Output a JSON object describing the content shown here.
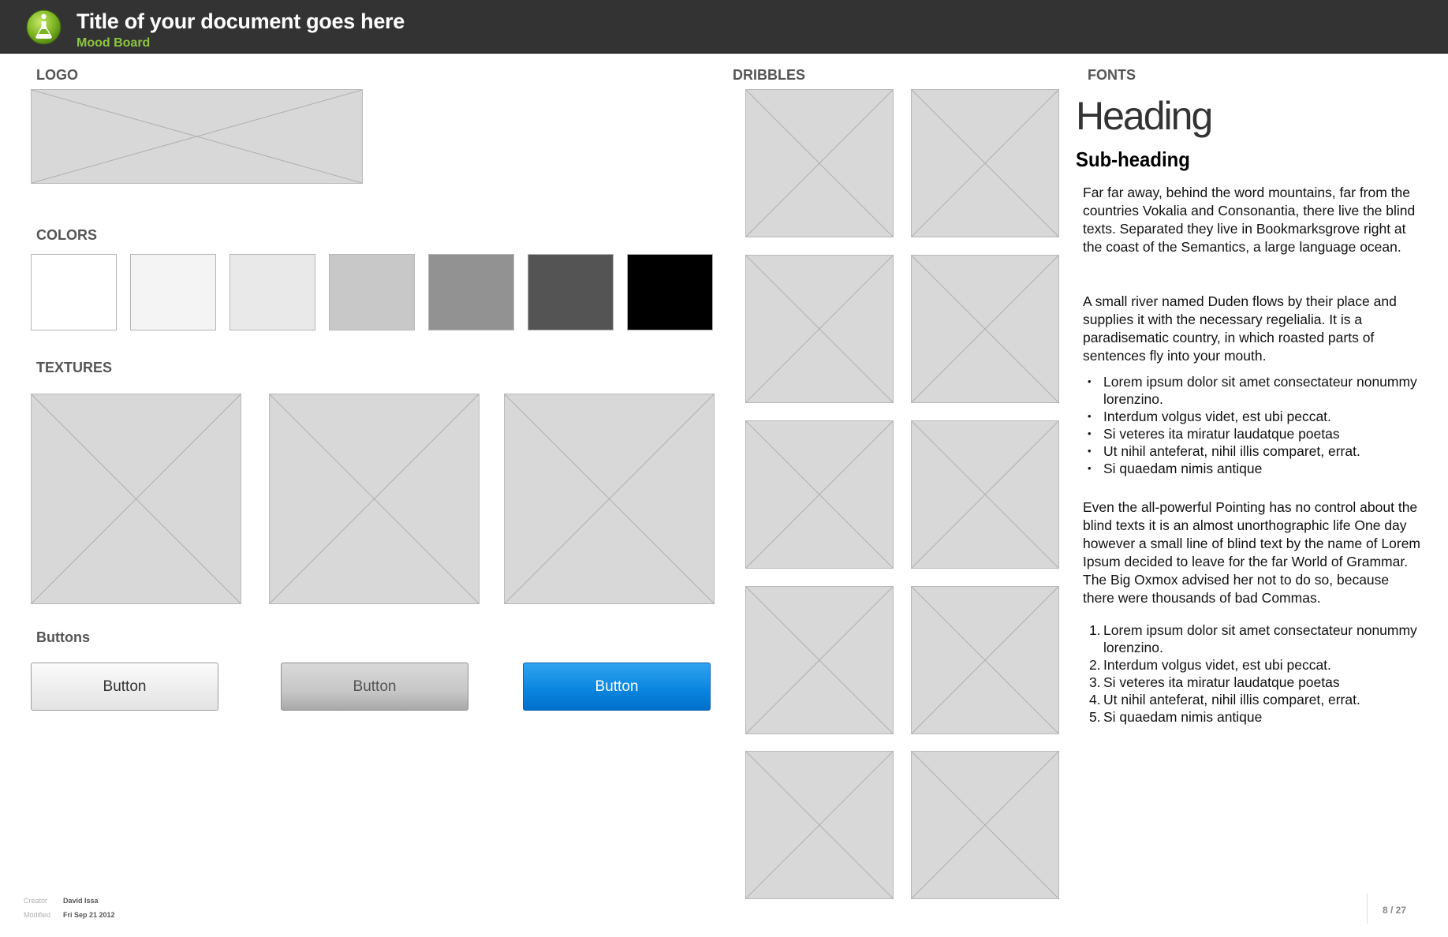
{
  "header": {
    "title": "Title of your document goes here",
    "subtitle": "Mood Board",
    "logo_icon": "flask-icon",
    "accent_color": "#8cc63f",
    "background_color": "#333333"
  },
  "sections": {
    "logo": "LOGO",
    "colors": "COLORS",
    "textures": "TEXTURES",
    "buttons": "Buttons",
    "dribbles": "DRIBBLES",
    "fonts": "FONTS"
  },
  "colors": [
    "#ffffff",
    "#f4f4f4",
    "#e9e9e9",
    "#c8c8c8",
    "#929292",
    "#545454",
    "#000000"
  ],
  "buttons": [
    {
      "label": "Button",
      "style": "default"
    },
    {
      "label": "Button",
      "style": "pressed"
    },
    {
      "label": "Button",
      "style": "primary",
      "color": "#0b86e0"
    }
  ],
  "fonts": {
    "heading": "Heading",
    "subheading": "Sub-heading",
    "paragraph1": "Far far away, behind the word mountains, far from the countries Vokalia and Consonantia, there live the blind texts. Separated they live in Bookmarksgrove right at the coast of the Semantics, a large language ocean.",
    "paragraph2": "A small river named Duden flows by their place and supplies it with the necessary regelialia. It is a paradisematic country, in which roasted parts of sentences fly into your mouth.",
    "bullets": [
      "Lorem ipsum dolor sit amet consectateur nonummy lorenzino.",
      "Interdum volgus videt, est ubi peccat.",
      "Si veteres ita miratur laudatque poetas",
      "Ut nihil anteferat, nihil illis comparet, errat.",
      "Si quaedam nimis antique"
    ],
    "paragraph3": "Even the all-powerful Pointing has no control about the blind texts it is an almost unorthographic life One day however a small line of blind text by the name of Lorem Ipsum decided to leave for the far World of Grammar. The Big Oxmox advised her not to do so, because there were thousands of bad Commas.",
    "numbered": [
      {
        "num": "1.",
        "text": "Lorem ipsum dolor sit amet consectateur nonummy lorenzino."
      },
      {
        "num": "2.",
        "text": "Interdum volgus videt, est ubi peccat."
      },
      {
        "num": "3.",
        "text": "Si veteres ita miratur laudatque poetas"
      },
      {
        "num": "4.",
        "text": "Ut nihil anteferat, nihil illis comparet, errat."
      },
      {
        "num": "5.",
        "text": "Si quaedam nimis antique"
      }
    ]
  },
  "footer": {
    "creator_label": "Creator",
    "creator_value": "David Issa",
    "modified_label": "Modified",
    "modified_value": "Fri Sep 21 2012",
    "page": "8 / 27"
  }
}
